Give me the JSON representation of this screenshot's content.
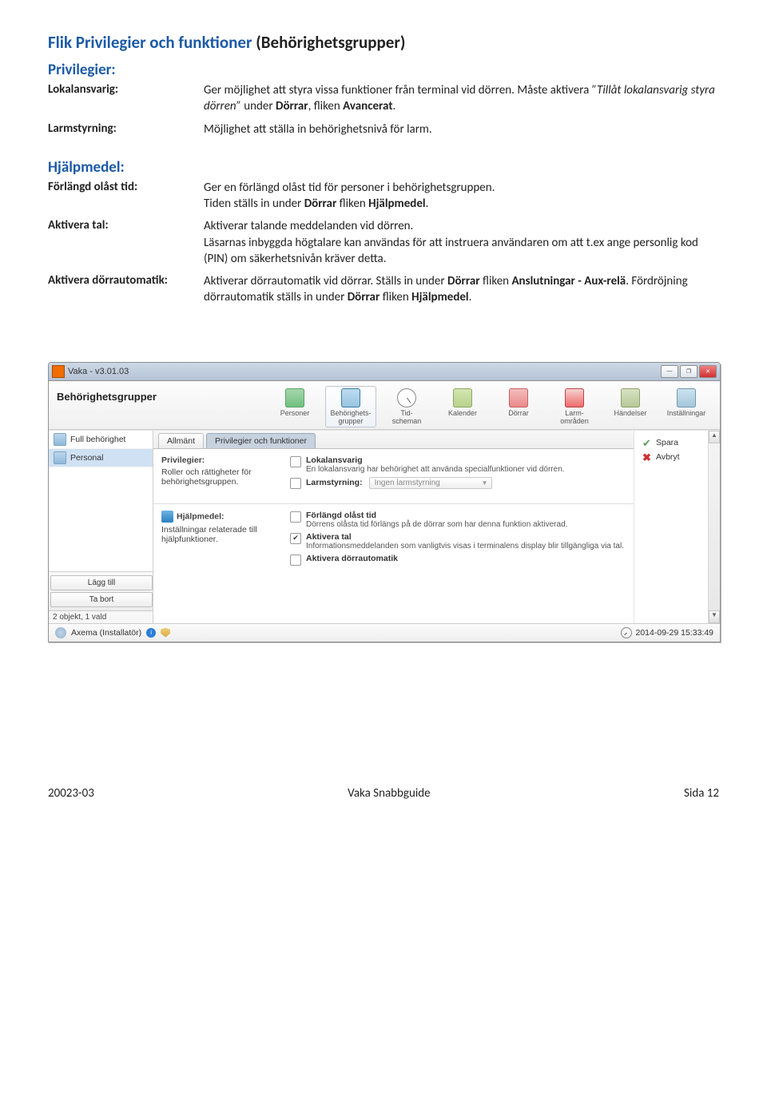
{
  "doc": {
    "h1_a": "Flik Privilegier och funktioner",
    "h1_b": " (Behörighetsgrupper)",
    "priv_heading": "Privilegier:",
    "lokal_label": "Lokalansvarig:",
    "lokal_body_a": "Ger möjlighet att styra vissa funktioner från terminal vid dörren. Måste aktivera ",
    "lokal_body_b": "”Tillåt lokalansvarig styra dörren”",
    "lokal_body_c": " under ",
    "lokal_body_d": "Dörrar",
    "lokal_body_e": ", fliken ",
    "lokal_body_f": "Avancerat",
    "lokal_body_g": ".",
    "larm_label": "Larmstyrning:",
    "larm_body": "Möjlighet att ställa in behörighetsnivå för larm.",
    "hjalp_heading": "Hjälpmedel:",
    "forlangd_label": "Förlängd olåst tid:",
    "forlangd_body_a": "Ger en förlängd olåst tid för personer i behörighetsgruppen.",
    "forlangd_body_b": "Tiden ställs in under ",
    "forlangd_body_c": "Dörrar",
    "forlangd_body_d": " fliken ",
    "forlangd_body_e": "Hjälpmedel",
    "forlangd_body_f": ".",
    "aktivera_tal_label": "Aktivera tal:",
    "aktivera_tal_body": "Aktiverar talande meddelanden vid dörren.\nLäsarnas inbyggda högtalare kan användas för att instruera användaren om att t.ex ange personlig kod (PIN) om säkerhetsnivån kräver detta.",
    "aktivera_dorr_label": "Aktivera dörrautomatik:",
    "aktivera_dorr_body_a": "Aktiverar dörrautomatik vid dörrar. Ställs in under ",
    "aktivera_dorr_body_b": "Dörrar",
    "aktivera_dorr_body_c": " fliken ",
    "aktivera_dorr_body_d": "Anslutningar - Aux-relä",
    "aktivera_dorr_body_e": ". Fördröjning dörrautomatik ställs in under ",
    "aktivera_dorr_body_f": "Dörrar",
    "aktivera_dorr_body_g": " fliken ",
    "aktivera_dorr_body_h": "Hjälpmedel",
    "aktivera_dorr_body_i": "."
  },
  "app": {
    "title": "Vaka - v3.01.03",
    "page_title": "Behörighetsgrupper",
    "nav": {
      "personer": "Personer",
      "behorig": "Behörighets-\ngrupper",
      "tid": "Tid-\nscheman",
      "kalender": "Kalender",
      "dorrar": "Dörrar",
      "larm": "Larm-\nområden",
      "handelser": "Händelser",
      "install": "Inställningar"
    },
    "sidebar": {
      "item1": "Full behörighet",
      "item2": "Personal",
      "btn_add": "Lägg till",
      "btn_del": "Ta bort",
      "status": "2 objekt, 1 vald"
    },
    "tabs": {
      "t1": "Allmänt",
      "t2": "Privilegier och funktioner"
    },
    "panel": {
      "priv_head": "Privilegier:",
      "priv_desc": "Roller och rättigheter för behörighetsgruppen.",
      "lokal_title": "Lokalansvarig",
      "lokal_desc": "En lokalansvarig har behörighet att använda specialfunktioner vid dörren.",
      "larm_label": "Larmstyrning:",
      "larm_dd": "Ingen larmstyrning",
      "hjalp_head": "Hjälpmedel:",
      "hjalp_desc": "Inställningar relaterade till hjälpfunktioner.",
      "forlangd_title": "Förlängd olåst tid",
      "forlangd_desc": "Dörrens olåsta tid förlängs på de dörrar som har denna funktion aktiverad.",
      "tal_title": "Aktivera tal",
      "tal_desc": "Informationsmeddelanden som vanligtvis visas i terminalens display blir tillgängliga via tal.",
      "dorrauto_title": "Aktivera dörrautomatik"
    },
    "actions": {
      "save": "Spara",
      "cancel": "Avbryt"
    },
    "statusbar": {
      "user": "Axema (Installatör)",
      "time": "2014-09-29 15:33:49"
    }
  },
  "footer": {
    "left": "20023-03",
    "center": "Vaka Snabbguide",
    "right": "Sida 12"
  }
}
